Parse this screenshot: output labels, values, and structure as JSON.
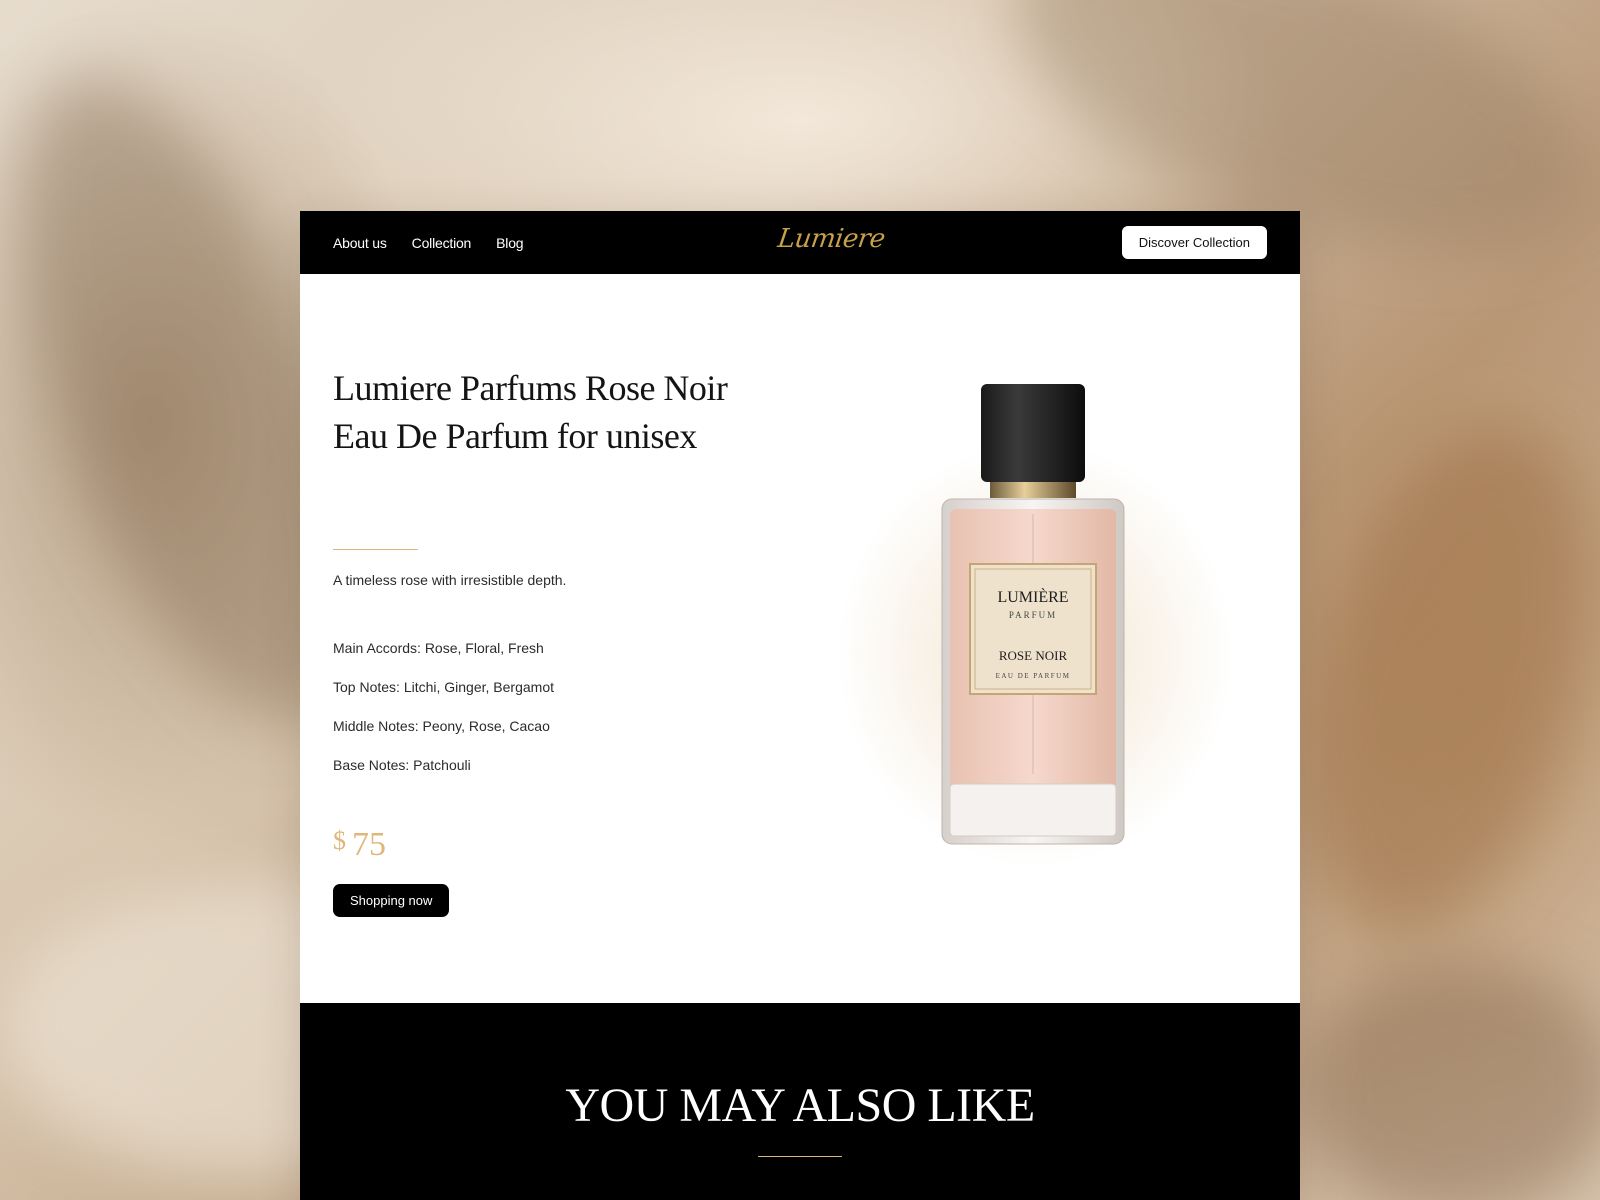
{
  "nav": {
    "links": [
      "About us",
      "Collection",
      "Blog"
    ],
    "logo": "Lumiere",
    "cta_label": "Discover Collection"
  },
  "product": {
    "title": "Lumiere Parfums Rose Noir Eau De Parfum for unisex",
    "tagline": "A timeless rose with irresistible depth.",
    "notes": [
      "Main Accords: Rose, Floral, Fresh",
      "Top Notes: Litchi, Ginger, Bergamot",
      "Middle Notes: Peony, Rose, Cacao",
      "Base Notes: Patchouli"
    ],
    "price_currency": "$",
    "price_value": "75",
    "shop_label": "Shopping now",
    "bottle_label": {
      "brand": "LUMIÈRE",
      "sub": "PARFUM",
      "name": "ROSE NOIR",
      "type": "EAU DE PARFUM"
    }
  },
  "section": {
    "title": "YOU MAY ALSO LIKE"
  },
  "colors": {
    "accent": "#d9b67c",
    "price": "#e0b77a",
    "logo": "#c9a04a",
    "dark": "#000000"
  }
}
